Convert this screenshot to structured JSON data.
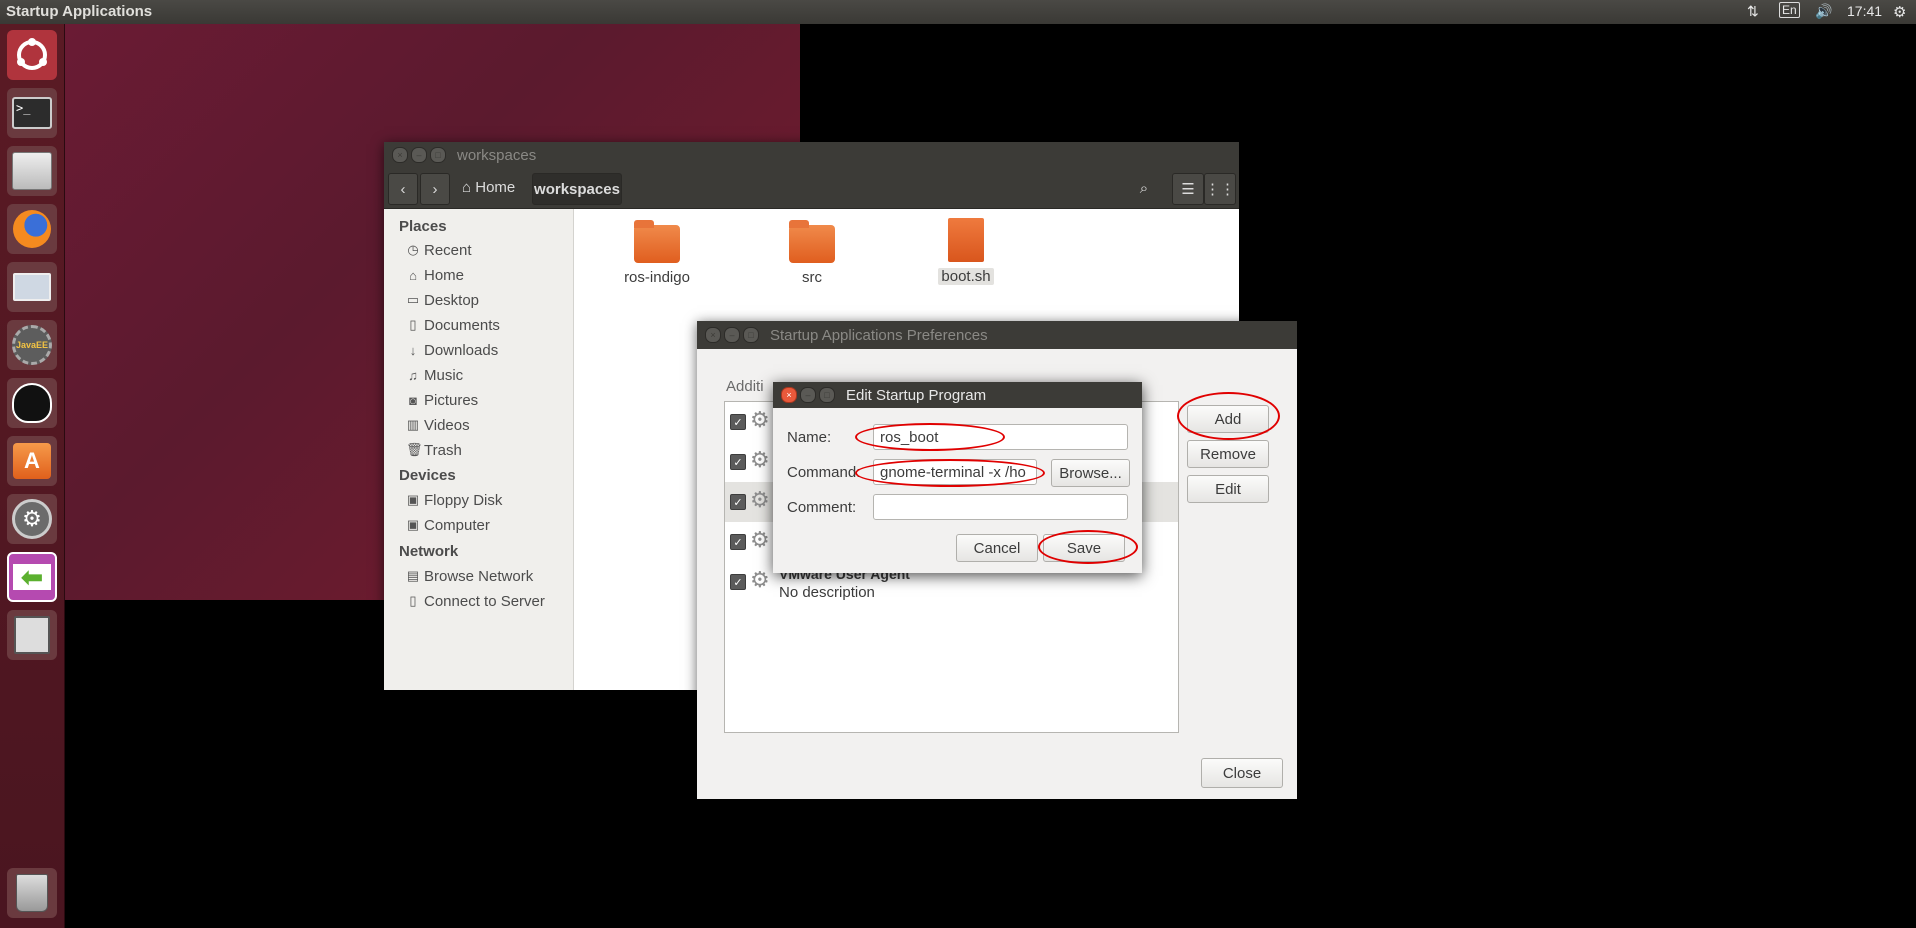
{
  "top_panel": {
    "title": "Startup Applications",
    "keyboard_layout": "En",
    "clock": "17:41"
  },
  "launcher": {
    "items": [
      "ubuntu-dash",
      "terminal",
      "files",
      "firefox",
      "remote-desktop",
      "eclipse-java-ee",
      "inkscape",
      "software-center",
      "system-settings",
      "startup-applications",
      "save-disk"
    ],
    "trash": "trash"
  },
  "file_manager": {
    "title": "workspaces",
    "breadcrumb": {
      "home": "Home",
      "current": "workspaces"
    },
    "sidebar": {
      "places_heading": "Places",
      "places": [
        "Recent",
        "Home",
        "Desktop",
        "Documents",
        "Downloads",
        "Music",
        "Pictures",
        "Videos",
        "Trash"
      ],
      "devices_heading": "Devices",
      "devices": [
        "Floppy Disk",
        "Computer"
      ],
      "network_heading": "Network",
      "network": [
        "Browse Network",
        "Connect to Server"
      ]
    },
    "files": [
      "ros-indigo",
      "src",
      "boot.sh"
    ]
  },
  "startup_prefs": {
    "title": "Startup Applications Preferences",
    "section_label": "Additi",
    "buttons": {
      "add": "Add",
      "remove": "Remove",
      "edit": "Edit",
      "close": "Close"
    },
    "last_item": {
      "name": "VMware User Agent",
      "description": "No description"
    }
  },
  "edit_dialog": {
    "title": "Edit Startup Program",
    "name_label": "Name:",
    "name_value": "ros_boot",
    "command_label": "Command:",
    "command_value": "gnome-terminal -x /ho",
    "browse_label": "Browse...",
    "comment_label": "Comment:",
    "comment_value": "",
    "cancel_label": "Cancel",
    "save_label": "Save"
  },
  "colors": {
    "annotation": "#e00000",
    "accent": "#e05e1f",
    "titlebar": "#3c3b37"
  }
}
